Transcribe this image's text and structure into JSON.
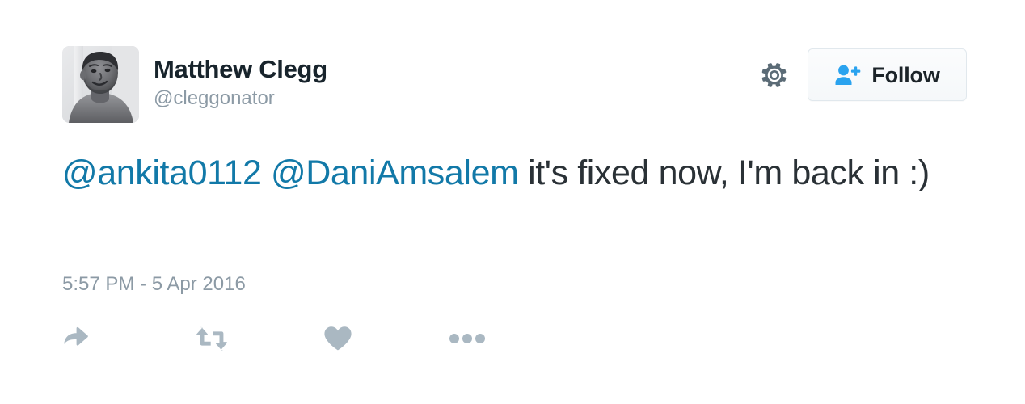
{
  "tweet": {
    "author": {
      "fullname": "Matthew Clegg",
      "username": "@cleggonator",
      "avatar_alt": "profile-photo"
    },
    "header_controls": {
      "gear_icon": "gear-icon",
      "follow": {
        "label": "Follow",
        "icon": "person-add-icon"
      }
    },
    "body": {
      "mention_1": "@ankita0112",
      "mention_2": "@DaniAmsalem",
      "text_rest": "it's fixed now, I'm back in :)",
      "full_text": "@ankita0112 @DaniAmsalem it's fixed now, I'm back in :)"
    },
    "timestamp": "5:57 PM - 5 Apr 2016",
    "actions": [
      {
        "name": "reply",
        "icon": "reply-arrow-icon"
      },
      {
        "name": "retweet",
        "icon": "retweet-icon"
      },
      {
        "name": "like",
        "icon": "heart-icon"
      },
      {
        "name": "more",
        "icon": "more-dots-icon"
      }
    ]
  },
  "colors": {
    "link_blue": "#1279a8",
    "follow_blue": "#2aa3ef",
    "text_dark": "#2a3136",
    "name_dark": "#18242c",
    "muted_gray": "#8c9aa5",
    "action_gray": "#aab8c2",
    "gear_gray": "#5b6b76",
    "background": "#ffffff"
  }
}
